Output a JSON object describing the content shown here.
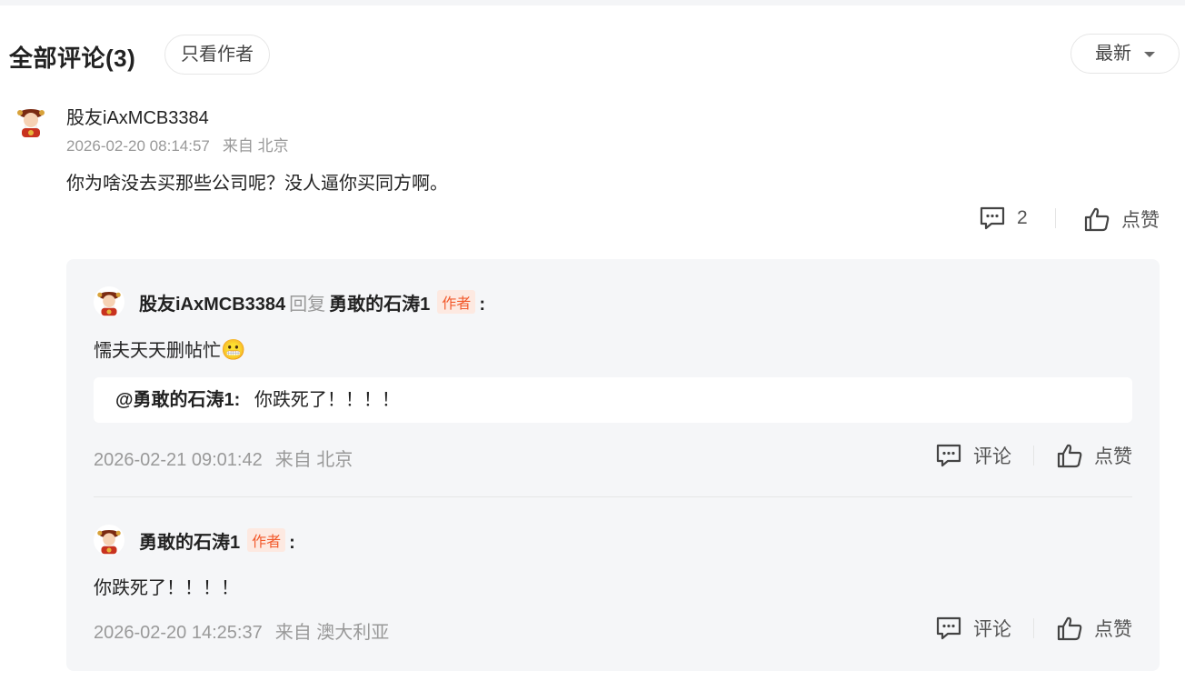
{
  "header": {
    "title": "全部评论(3)",
    "author_only": "只看作者",
    "sort": "最新"
  },
  "comment": {
    "user": "股友iAxMCB3384",
    "time": "2026-02-20 08:14:57",
    "location": "来自 北京",
    "text": "你为啥没去买那些公司呢？没人逼你买同方啊。",
    "reply_count": "2",
    "like_label": "点赞"
  },
  "replies": [
    {
      "user": "股友iAxMCB3384",
      "reply_word": "回复",
      "target": "勇敢的石涛1",
      "target_badge": "作者",
      "colon": ":",
      "text": "懦夫天天删帖忙",
      "emoji": "😬",
      "quote_user": "@勇敢的石涛1:",
      "quote_text": "你跌死了！！！！",
      "time": "2026-02-21 09:01:42",
      "location": "来自 北京",
      "comment_label": "评论",
      "like_label": "点赞"
    },
    {
      "user": "勇敢的石涛1",
      "badge": "作者",
      "colon": ":",
      "text": "你跌死了！！！！",
      "time": "2026-02-20 14:25:37",
      "location": "来自 澳大利亚",
      "comment_label": "评论",
      "like_label": "点赞"
    }
  ],
  "colors": {
    "accent": "#f25a2c",
    "badge_bg": "#fde9e1",
    "muted": "#999999",
    "panel": "#f5f6f8"
  }
}
